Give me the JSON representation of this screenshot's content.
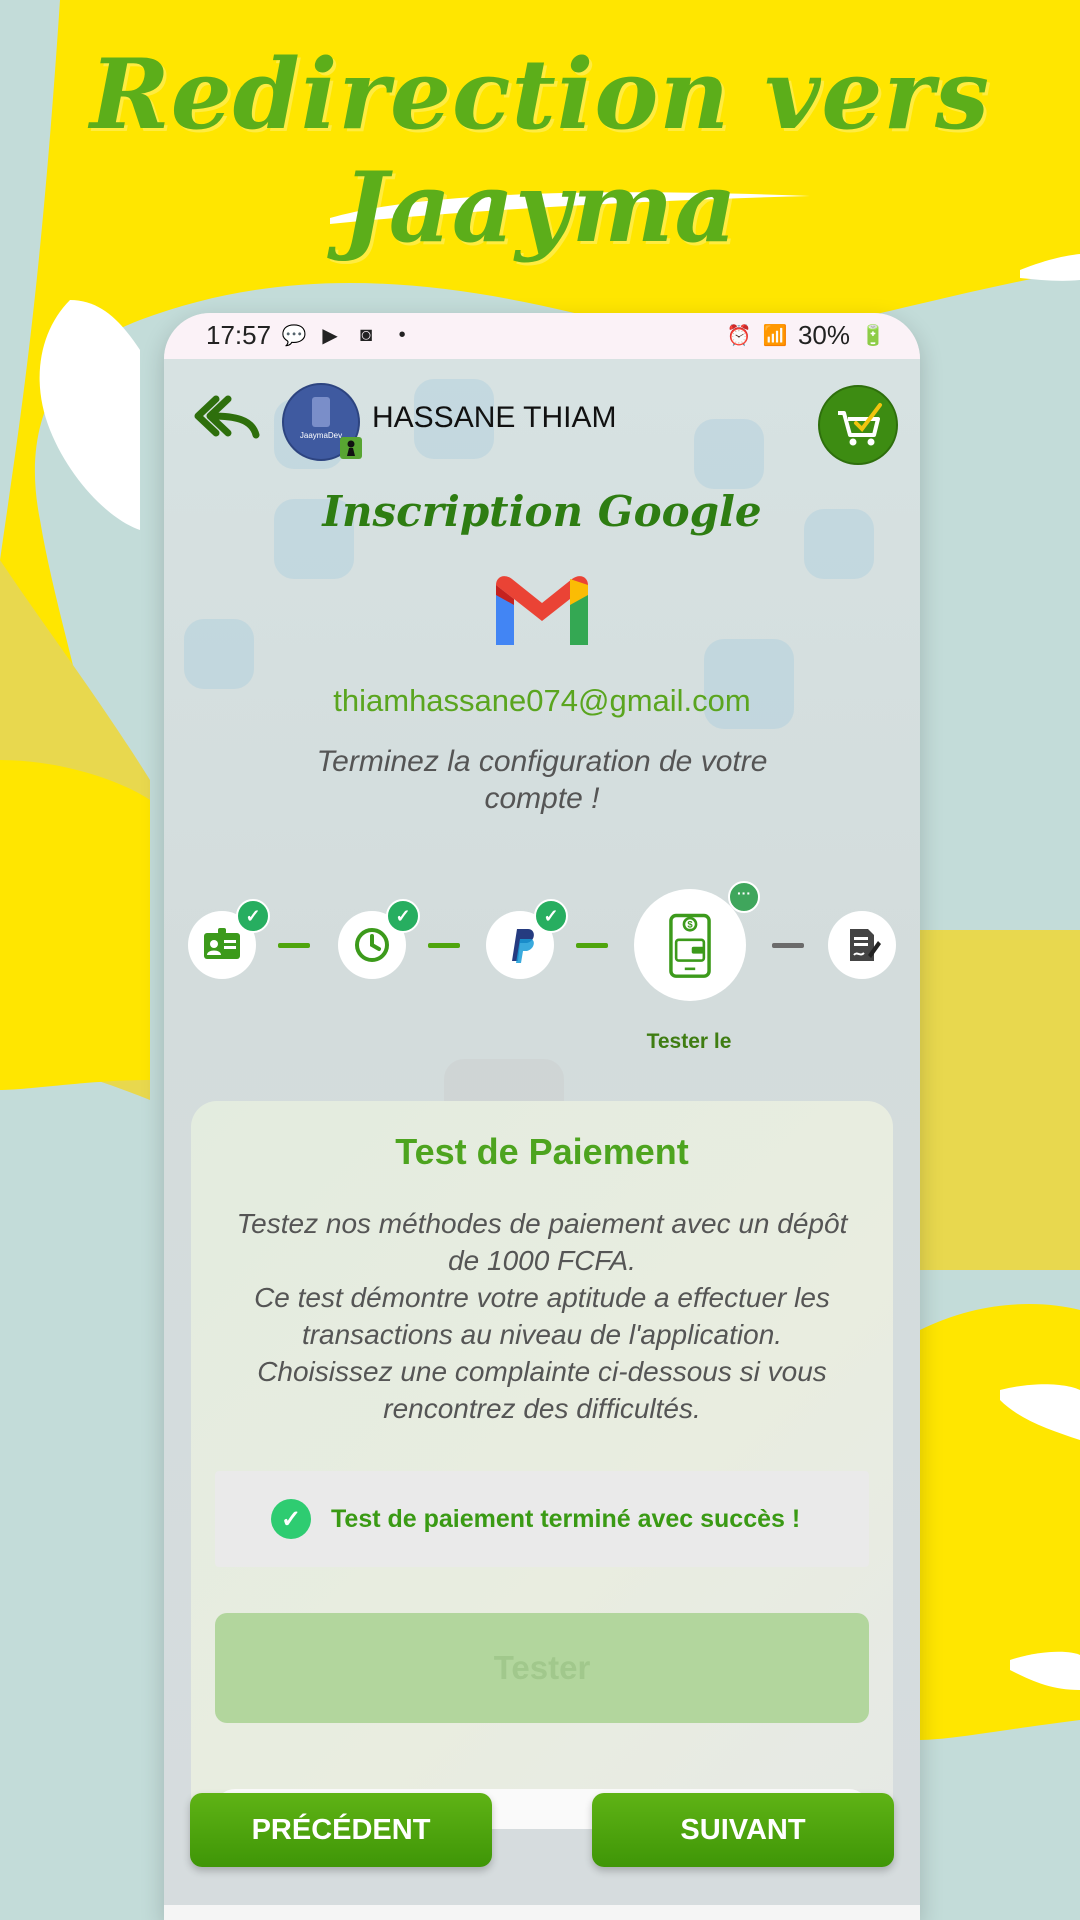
{
  "promo": {
    "title": "Redirection vers Jaayma"
  },
  "statusbar": {
    "time": "17:57",
    "battery": "30%"
  },
  "header": {
    "user_name": "HASSANE THIAM",
    "avatar_text": "JaaymaDev"
  },
  "main": {
    "subtitle": "Inscription Google",
    "email": "thiamhassane074@gmail.com",
    "finish_text": "Terminez la configuration de votre compte !"
  },
  "stepper": {
    "steps": [
      {
        "icon": "id-card-icon",
        "status": "done"
      },
      {
        "icon": "clock-icon",
        "status": "done"
      },
      {
        "icon": "paypal-icon",
        "status": "done"
      },
      {
        "icon": "wallet-phone-icon",
        "status": "current",
        "label": "Tester le"
      },
      {
        "icon": "document-sign-icon",
        "status": "pending"
      }
    ]
  },
  "card": {
    "title": "Test de Paiement",
    "description": "Testez nos méthodes de paiement avec un dépôt de 1000 FCFA.\nCe test démontre votre aptitude a effectuer les transactions au niveau de l'application.\nChoisissez une complainte ci-dessous si vous rencontrez des difficultés.",
    "success_message": "Test de paiement terminé avec succès !",
    "tester_label": "Tester"
  },
  "nav": {
    "previous_label": "PRÉCÉDENT",
    "next_label": "SUIVANT"
  },
  "colors": {
    "accent_green": "#4da41f",
    "promo_yellow": "#ffe600",
    "button_green": "#4fa50d"
  }
}
